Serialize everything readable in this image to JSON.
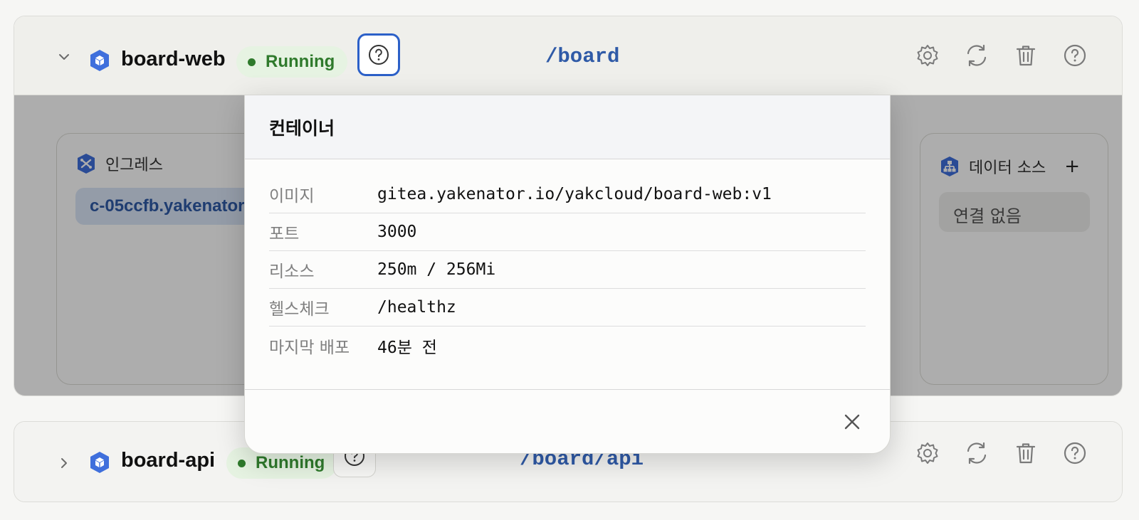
{
  "services": [
    {
      "name": "board-web",
      "status": "Running",
      "route": "/board",
      "expanded": true
    },
    {
      "name": "board-api",
      "status": "Running",
      "route": "/board/api",
      "expanded": false
    }
  ],
  "ingress": {
    "title": "인그레스",
    "host": "c-05ccfb.yakenator"
  },
  "datasource": {
    "title": "데이터 소스",
    "add_label": "+",
    "empty_label": "연결 없음"
  },
  "popover": {
    "title": "컨테이너",
    "rows": [
      {
        "key": "이미지",
        "value": "gitea.yakenator.io/yakcloud/board-web:v1"
      },
      {
        "key": "포트",
        "value": "3000"
      },
      {
        "key": "리소스",
        "value": "250m / 256Mi"
      },
      {
        "key": "헬스체크",
        "value": "/healthz"
      },
      {
        "key": "마지막 배포",
        "value": "46분 전"
      }
    ]
  },
  "icons": {
    "chevron_expanded": "chevron-down-icon",
    "chevron_collapsed": "chevron-right-icon",
    "service": "cube-icon",
    "help": "question-circle-icon",
    "settings": "gear-icon",
    "restart": "refresh-icon",
    "delete": "trash-icon",
    "close": "close-icon",
    "ingress": "ingress-icon",
    "datasource": "hierarchy-icon"
  },
  "colors": {
    "accent_blue": "#2c60c8",
    "running_green": "#2f7a2c",
    "route_blue": "#2f5aa7"
  }
}
